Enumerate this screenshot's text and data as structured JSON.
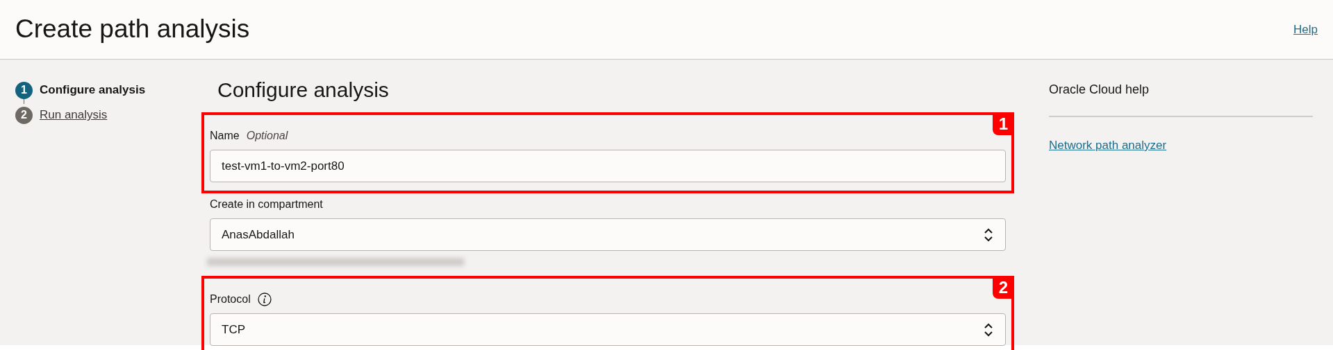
{
  "header": {
    "title": "Create path analysis",
    "help_link": "Help"
  },
  "steps": [
    {
      "number": "1",
      "label": "Configure analysis",
      "selected": true
    },
    {
      "number": "2",
      "label": "Run analysis",
      "selected": false
    }
  ],
  "form": {
    "title": "Configure analysis",
    "fields": [
      {
        "kind": "text",
        "label": "Name",
        "hint": "Optional",
        "value": "test-vm1-to-vm2-port80",
        "annotation": "1"
      },
      {
        "kind": "select",
        "label": "Create in compartment",
        "value": "AnasAbdallah",
        "redacted_below": true
      },
      {
        "kind": "select",
        "label": "Protocol",
        "info": true,
        "value": "TCP",
        "annotation": "2"
      }
    ]
  },
  "help_panel": {
    "title": "Oracle Cloud help",
    "links": [
      "Network path analyzer"
    ]
  }
}
